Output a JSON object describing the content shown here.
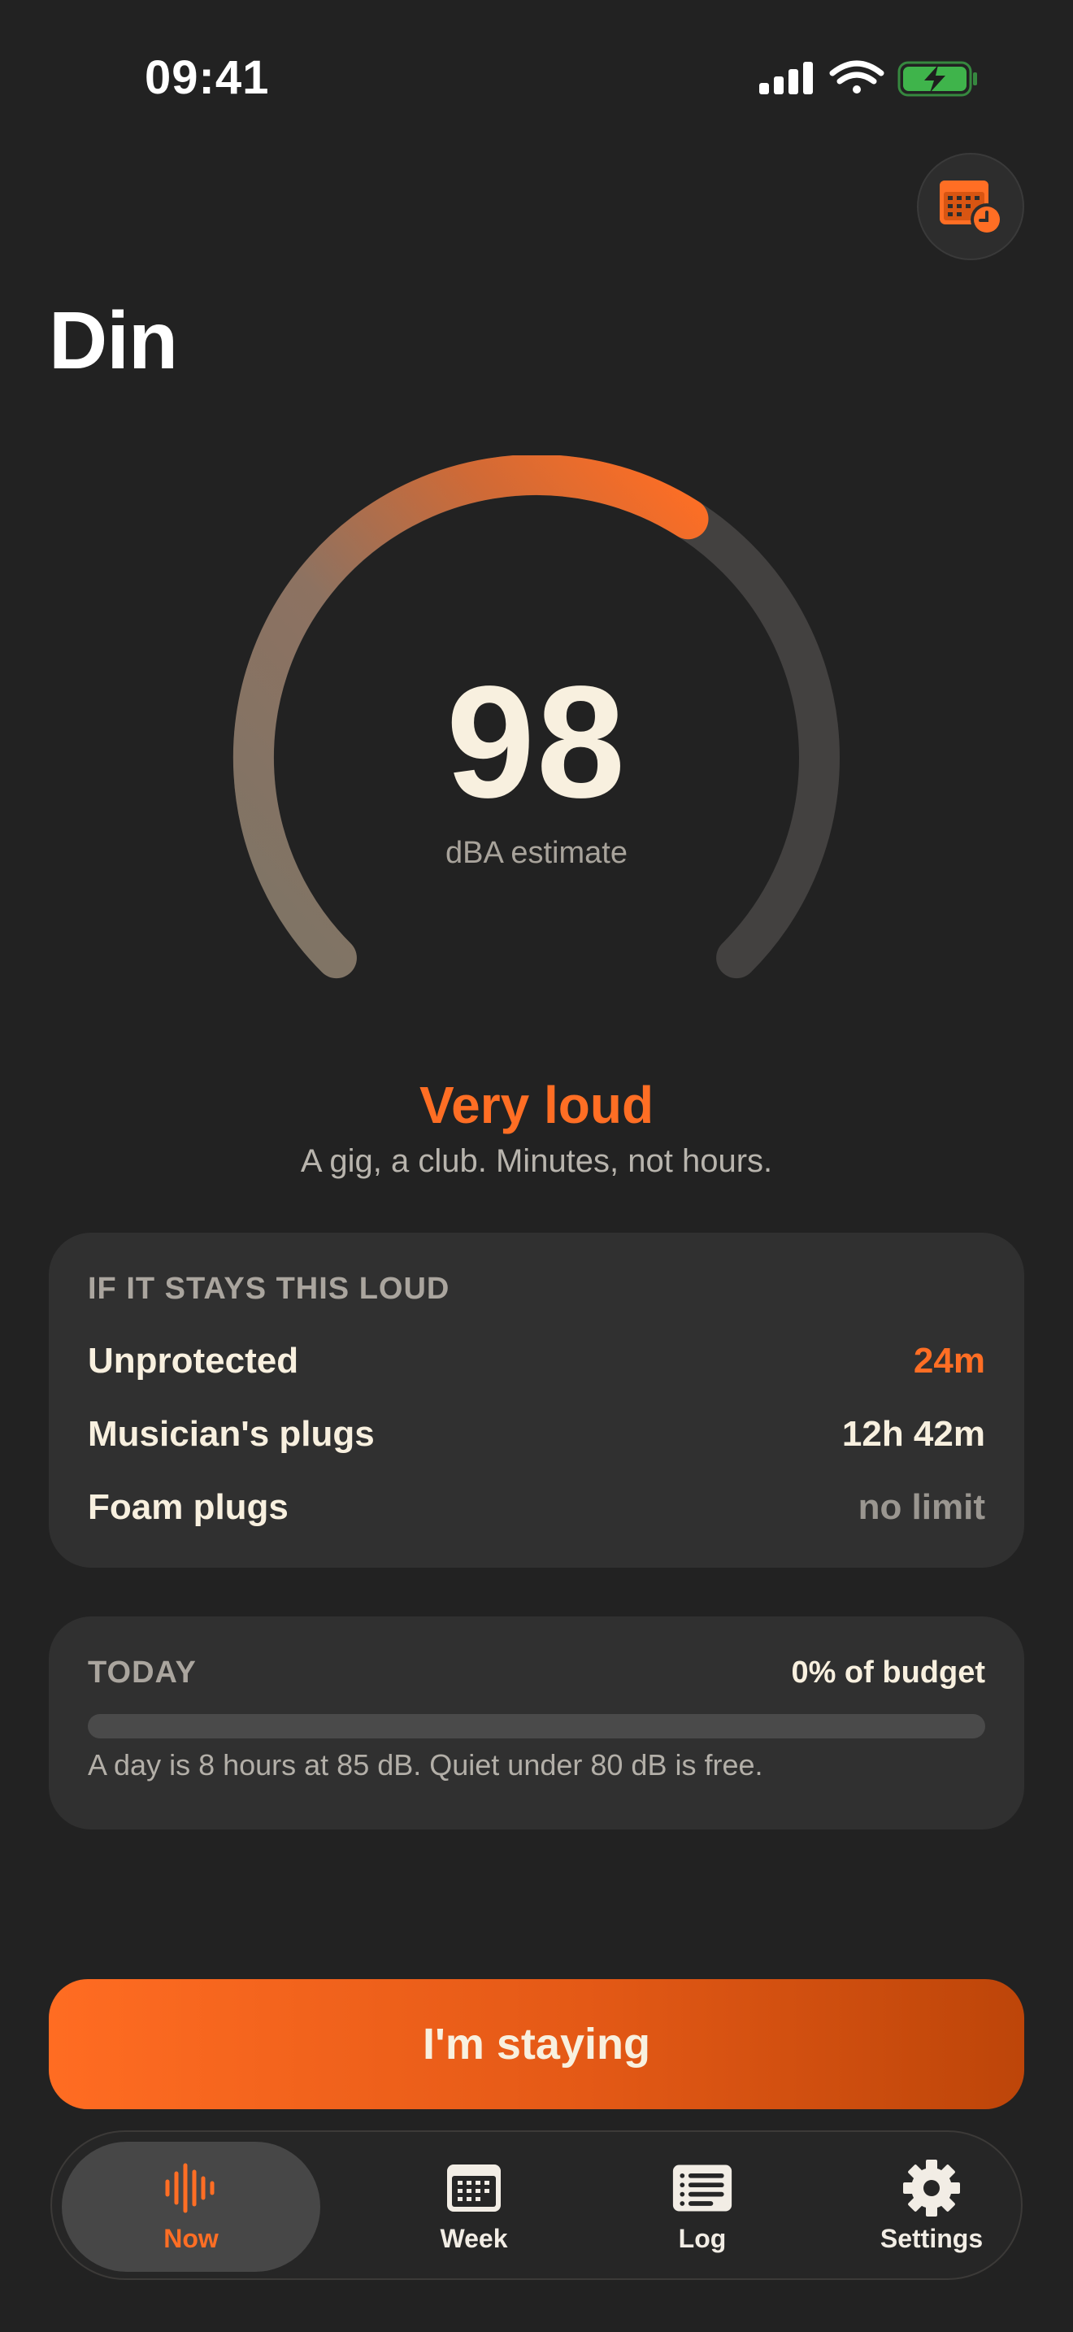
{
  "status_bar": {
    "time": "09:41",
    "icons": [
      "cellular-signal-icon",
      "wifi-icon",
      "battery-charging-icon"
    ]
  },
  "header": {
    "title": "Din",
    "history_button_icon": "calendar-clock-icon"
  },
  "meter": {
    "value": "98",
    "unit": "dBA estimate",
    "level_fraction": 0.62,
    "level_label": "Very loud",
    "level_description": "A gig, a club. Minutes, not hours."
  },
  "exposure": {
    "heading": "IF IT STAYS THIS LOUD",
    "rows": [
      {
        "label": "Unprotected",
        "value": "24m",
        "color": "#ff6e24"
      },
      {
        "label": "Musician's plugs",
        "value": "12h 42m",
        "color": "#f8f0df"
      },
      {
        "label": "Foam plugs",
        "value": "no limit",
        "color": "#9a9690"
      }
    ]
  },
  "today": {
    "heading": "TODAY",
    "budget": "0% of budget",
    "budget_fraction": 0,
    "note": "A day is 8 hours at 85 dB. Quiet under 80 dB is free."
  },
  "action": {
    "label": "I'm staying"
  },
  "tabs": [
    {
      "label": "Now",
      "icon": "waveform-icon",
      "active": true
    },
    {
      "label": "Week",
      "icon": "calendar-icon",
      "active": false
    },
    {
      "label": "Log",
      "icon": "list-icon",
      "active": false
    },
    {
      "label": "Settings",
      "icon": "gear-icon",
      "active": false
    }
  ],
  "colors": {
    "accent": "#ff6e24",
    "background": "#222222",
    "card": "#303030",
    "cream_text": "#f8f0df"
  }
}
